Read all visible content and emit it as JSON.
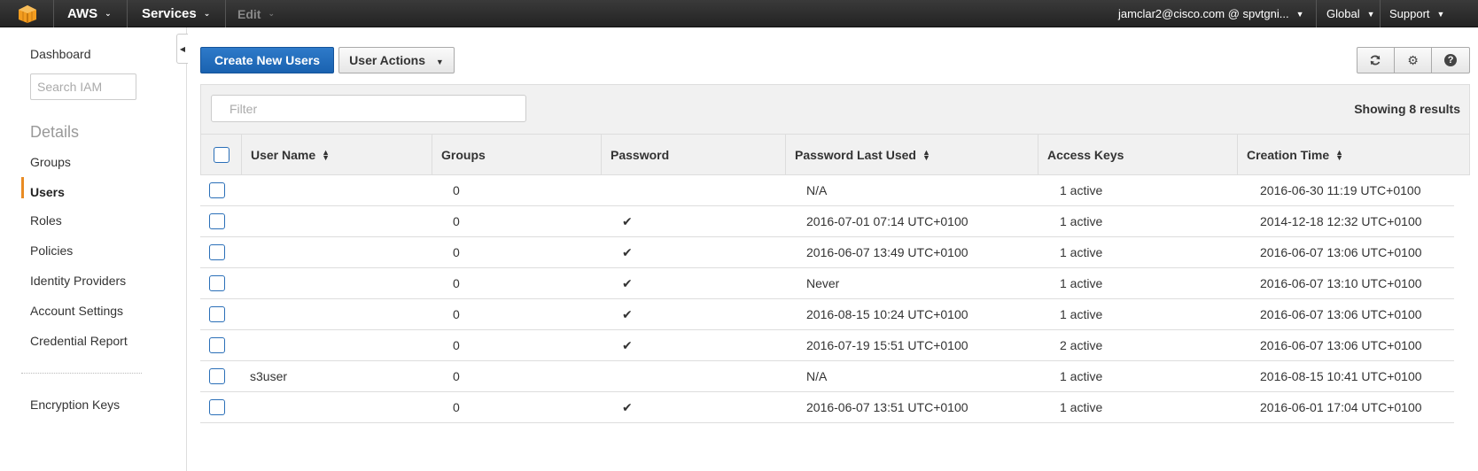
{
  "topbar": {
    "brand": "AWS",
    "services": "Services",
    "edit": "Edit",
    "account": "jamclar2@cisco.com @ spvtgni...",
    "region": "Global",
    "support": "Support",
    "caret": "▼"
  },
  "sidebar": {
    "dashboard": "Dashboard",
    "search_placeholder": "Search IAM",
    "details_heading": "Details",
    "items": [
      {
        "label": "Groups",
        "active": false
      },
      {
        "label": "Users",
        "active": true
      },
      {
        "label": "Roles",
        "active": false
      },
      {
        "label": "Policies",
        "active": false
      },
      {
        "label": "Identity Providers",
        "active": false
      },
      {
        "label": "Account Settings",
        "active": false
      },
      {
        "label": "Credential Report",
        "active": false
      }
    ],
    "encryption_keys": "Encryption Keys",
    "active_color": "#e98b23"
  },
  "toolbar": {
    "create_label": "Create New Users",
    "actions_label": "User Actions",
    "icons": [
      "refresh-icon",
      "gear-icon",
      "help-icon"
    ]
  },
  "grid": {
    "filter_placeholder": "Filter",
    "results_text": "Showing 8 results",
    "columns": [
      "User Name",
      "Groups",
      "Password",
      "Password Last Used",
      "Access Keys",
      "Creation Time"
    ],
    "sortable": [
      true,
      false,
      false,
      true,
      false,
      true
    ],
    "check_glyph": "✔",
    "rows": [
      {
        "user": "",
        "groups": "0",
        "password": "",
        "last_used": "N/A",
        "keys": "1 active",
        "created": "2016-06-30 11:19 UTC+0100"
      },
      {
        "user": "",
        "groups": "0",
        "password": "✔",
        "last_used": "2016-07-01 07:14 UTC+0100",
        "keys": "1 active",
        "created": "2014-12-18 12:32 UTC+0100"
      },
      {
        "user": "",
        "groups": "0",
        "password": "✔",
        "last_used": "2016-06-07 13:49 UTC+0100",
        "keys": "1 active",
        "created": "2016-06-07 13:06 UTC+0100"
      },
      {
        "user": "",
        "groups": "0",
        "password": "✔",
        "last_used": "Never",
        "keys": "1 active",
        "created": "2016-06-07 13:10 UTC+0100"
      },
      {
        "user": "",
        "groups": "0",
        "password": "✔",
        "last_used": "2016-08-15 10:24 UTC+0100",
        "keys": "1 active",
        "created": "2016-06-07 13:06 UTC+0100"
      },
      {
        "user": "",
        "groups": "0",
        "password": "✔",
        "last_used": "2016-07-19 15:51 UTC+0100",
        "keys": "2 active",
        "created": "2016-06-07 13:06 UTC+0100"
      },
      {
        "user": "s3user",
        "groups": "0",
        "password": "",
        "last_used": "N/A",
        "keys": "1 active",
        "created": "2016-08-15 10:41 UTC+0100"
      },
      {
        "user": "",
        "groups": "0",
        "password": "✔",
        "last_used": "2016-06-07 13:51 UTC+0100",
        "keys": "1 active",
        "created": "2016-06-01 17:04 UTC+0100"
      }
    ]
  },
  "colors": {
    "primary_button": "#1a62b0",
    "topbar": "#2b2b2b",
    "checkbox_border": "#2a6fb8"
  }
}
